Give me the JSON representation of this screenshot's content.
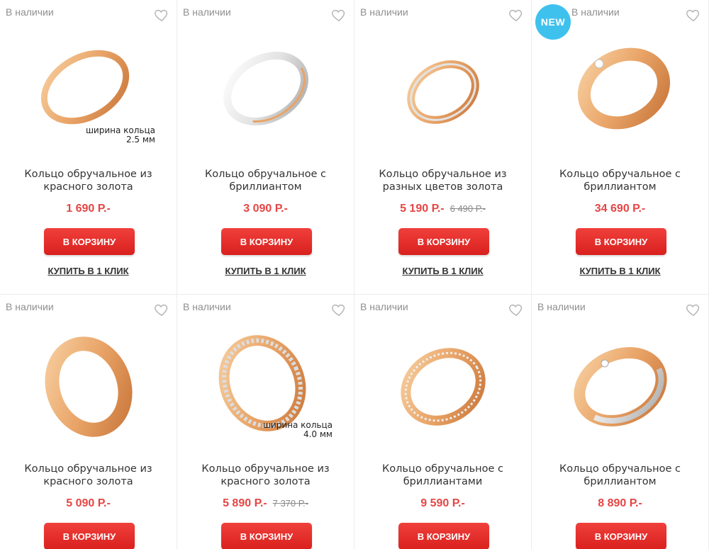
{
  "products": [
    {
      "stock": "В наличии",
      "title_line1": "Кольцо обручальное из",
      "title_line2": "красного золота",
      "price": "1 690 Р.-",
      "old_price": "",
      "is_new": false,
      "width_note_line1": "ширина кольца",
      "width_note_line2": "2.5 мм",
      "ring": "gold-thin"
    },
    {
      "stock": "В наличии",
      "title_line1": "Кольцо обручальное с",
      "title_line2": "бриллиантом",
      "price": "3 090 Р.-",
      "old_price": "",
      "is_new": false,
      "width_note_line1": "",
      "width_note_line2": "",
      "ring": "two-tone"
    },
    {
      "stock": "В наличии",
      "title_line1": "Кольцо обручальное из",
      "title_line2": "разных цветов золота",
      "price": "5 190 Р.-",
      "old_price": "6 490 Р.-",
      "is_new": false,
      "width_note_line1": "",
      "width_note_line2": "",
      "ring": "gold-stripe"
    },
    {
      "stock": "В наличии",
      "title_line1": "Кольцо обручальное с",
      "title_line2": "бриллиантом",
      "price": "34 690 Р.-",
      "old_price": "",
      "is_new": true,
      "new_label": "NEW",
      "width_note_line1": "",
      "width_note_line2": "",
      "ring": "rose-diamond"
    },
    {
      "stock": "В наличии",
      "title_line1": "Кольцо обручальное из",
      "title_line2": "красного золота",
      "price": "5 090 Р.-",
      "old_price": "",
      "is_new": false,
      "width_note_line1": "",
      "width_note_line2": "",
      "ring": "gold-wide"
    },
    {
      "stock": "В наличии",
      "title_line1": "Кольцо обручальное из",
      "title_line2": "красного золота",
      "price": "5 890 Р.-",
      "old_price": "7 370 Р.-",
      "is_new": false,
      "width_note_line1": "ширина кольца",
      "width_note_line2": "4.0 мм",
      "ring": "gold-diamond-cut"
    },
    {
      "stock": "В наличии",
      "title_line1": "Кольцо обручальное с",
      "title_line2": "бриллиантами",
      "price": "9 590 Р.-",
      "old_price": "",
      "is_new": false,
      "width_note_line1": "",
      "width_note_line2": "",
      "ring": "gold-channel"
    },
    {
      "stock": "В наличии",
      "title_line1": "Кольцо обручальное с",
      "title_line2": "бриллиантом",
      "price": "8 890 Р.-",
      "old_price": "",
      "is_new": false,
      "width_note_line1": "",
      "width_note_line2": "",
      "ring": "white-rose"
    }
  ],
  "labels": {
    "cart_button": "В КОРЗИНУ",
    "one_click": "КУПИТЬ В 1 КЛИК"
  },
  "colors": {
    "price": "#e64545",
    "button": "#e8302c",
    "new_badge": "#3fc1ee",
    "gold": "#e9a467",
    "white_gold": "#d9d9d9"
  },
  "icons": {
    "favorite": "heart-outline-icon"
  }
}
